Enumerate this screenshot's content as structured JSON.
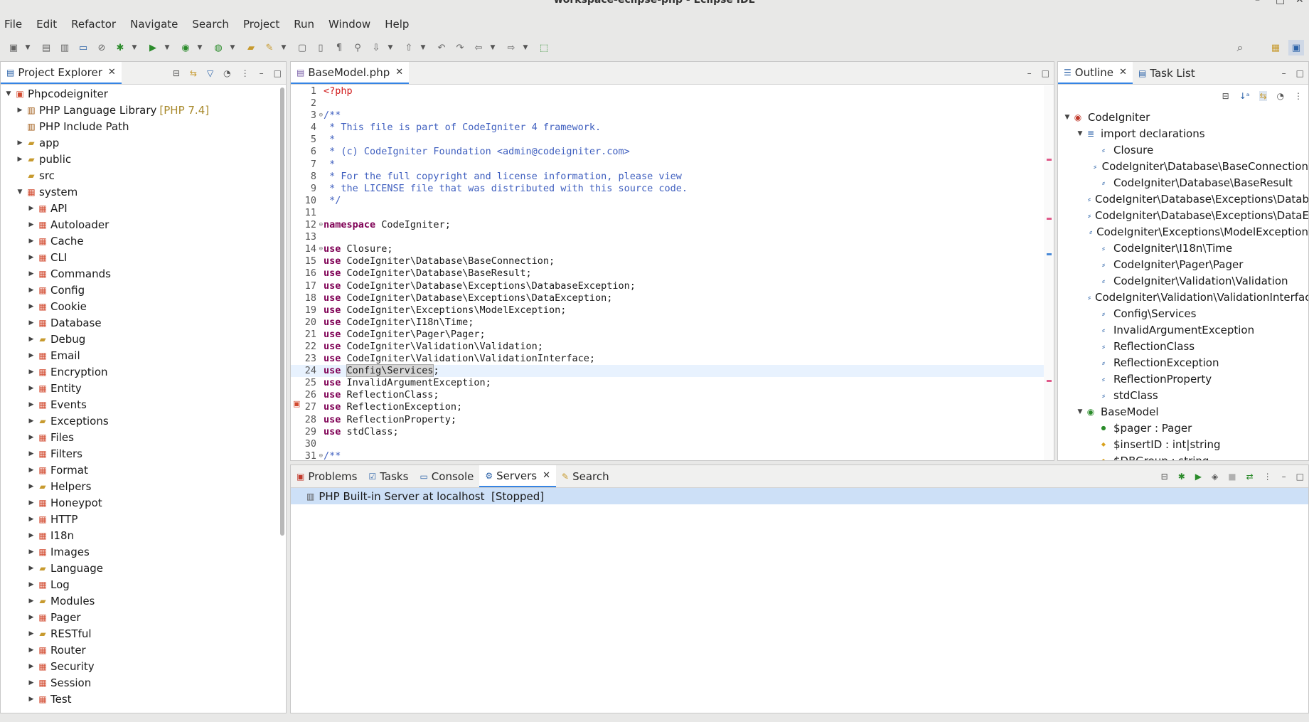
{
  "window": {
    "title": "workspace-eclipse-php - Eclipse IDE"
  },
  "menu": [
    "File",
    "Edit",
    "Refactor",
    "Navigate",
    "Search",
    "Project",
    "Run",
    "Window",
    "Help"
  ],
  "project_explorer": {
    "tab_label": "Project Explorer",
    "items": [
      {
        "label": "Phpcodeigniter",
        "level": 0,
        "expander": "open",
        "icon": "project-icon"
      },
      {
        "label": "PHP Language Library",
        "suffix": "[PHP 7.4]",
        "level": 1,
        "expander": "closed",
        "icon": "library-icon"
      },
      {
        "label": "PHP Include Path",
        "level": 1,
        "expander": "none",
        "icon": "library-icon"
      },
      {
        "label": "app",
        "level": 1,
        "expander": "closed",
        "icon": "folder-icon"
      },
      {
        "label": "public",
        "level": 1,
        "expander": "closed",
        "icon": "folder-icon"
      },
      {
        "label": "src",
        "level": 1,
        "expander": "none",
        "icon": "folder-icon"
      },
      {
        "label": "system",
        "level": 1,
        "expander": "open",
        "icon": "package-icon"
      },
      {
        "label": "API",
        "level": 2,
        "expander": "closed",
        "icon": "package-icon"
      },
      {
        "label": "Autoloader",
        "level": 2,
        "expander": "closed",
        "icon": "package-icon"
      },
      {
        "label": "Cache",
        "level": 2,
        "expander": "closed",
        "icon": "package-icon"
      },
      {
        "label": "CLI",
        "level": 2,
        "expander": "closed",
        "icon": "package-icon"
      },
      {
        "label": "Commands",
        "level": 2,
        "expander": "closed",
        "icon": "package-icon"
      },
      {
        "label": "Config",
        "level": 2,
        "expander": "closed",
        "icon": "package-icon"
      },
      {
        "label": "Cookie",
        "level": 2,
        "expander": "closed",
        "icon": "package-icon"
      },
      {
        "label": "Database",
        "level": 2,
        "expander": "closed",
        "icon": "package-icon"
      },
      {
        "label": "Debug",
        "level": 2,
        "expander": "closed",
        "icon": "folder-icon"
      },
      {
        "label": "Email",
        "level": 2,
        "expander": "closed",
        "icon": "package-icon"
      },
      {
        "label": "Encryption",
        "level": 2,
        "expander": "closed",
        "icon": "package-icon"
      },
      {
        "label": "Entity",
        "level": 2,
        "expander": "closed",
        "icon": "package-icon"
      },
      {
        "label": "Events",
        "level": 2,
        "expander": "closed",
        "icon": "package-icon"
      },
      {
        "label": "Exceptions",
        "level": 2,
        "expander": "closed",
        "icon": "folder-icon"
      },
      {
        "label": "Files",
        "level": 2,
        "expander": "closed",
        "icon": "package-icon"
      },
      {
        "label": "Filters",
        "level": 2,
        "expander": "closed",
        "icon": "package-icon"
      },
      {
        "label": "Format",
        "level": 2,
        "expander": "closed",
        "icon": "package-icon"
      },
      {
        "label": "Helpers",
        "level": 2,
        "expander": "closed",
        "icon": "folder-icon"
      },
      {
        "label": "Honeypot",
        "level": 2,
        "expander": "closed",
        "icon": "package-icon"
      },
      {
        "label": "HTTP",
        "level": 2,
        "expander": "closed",
        "icon": "package-icon"
      },
      {
        "label": "I18n",
        "level": 2,
        "expander": "closed",
        "icon": "package-icon"
      },
      {
        "label": "Images",
        "level": 2,
        "expander": "closed",
        "icon": "package-icon"
      },
      {
        "label": "Language",
        "level": 2,
        "expander": "closed",
        "icon": "folder-icon"
      },
      {
        "label": "Log",
        "level": 2,
        "expander": "closed",
        "icon": "package-icon"
      },
      {
        "label": "Modules",
        "level": 2,
        "expander": "closed",
        "icon": "folder-icon"
      },
      {
        "label": "Pager",
        "level": 2,
        "expander": "closed",
        "icon": "package-icon"
      },
      {
        "label": "RESTful",
        "level": 2,
        "expander": "closed",
        "icon": "folder-icon"
      },
      {
        "label": "Router",
        "level": 2,
        "expander": "closed",
        "icon": "package-icon"
      },
      {
        "label": "Security",
        "level": 2,
        "expander": "closed",
        "icon": "package-icon"
      },
      {
        "label": "Session",
        "level": 2,
        "expander": "closed",
        "icon": "package-icon"
      },
      {
        "label": "Test",
        "level": 2,
        "expander": "closed",
        "icon": "package-icon"
      }
    ]
  },
  "editor": {
    "tab_label": "BaseModel.php",
    "lines": [
      {
        "n": "1",
        "parts": [
          [
            "tag",
            "<?php"
          ]
        ]
      },
      {
        "n": "2",
        "parts": []
      },
      {
        "n": "3",
        "fold": true,
        "parts": [
          [
            "cm",
            "/**"
          ]
        ]
      },
      {
        "n": "4",
        "parts": [
          [
            "cm",
            " * This file is part of CodeIgniter 4 framework."
          ]
        ]
      },
      {
        "n": "5",
        "parts": [
          [
            "cm",
            " *"
          ]
        ]
      },
      {
        "n": "6",
        "parts": [
          [
            "cm",
            " * (c) CodeIgniter Foundation <admin@codeigniter.com>"
          ]
        ]
      },
      {
        "n": "7",
        "parts": [
          [
            "cm",
            " *"
          ]
        ]
      },
      {
        "n": "8",
        "parts": [
          [
            "cm",
            " * For the full copyright and license information, please view"
          ]
        ]
      },
      {
        "n": "9",
        "parts": [
          [
            "cm",
            " * the LICENSE file that was distributed with this source code."
          ]
        ]
      },
      {
        "n": "10",
        "parts": [
          [
            "cm",
            " */"
          ]
        ]
      },
      {
        "n": "11",
        "parts": []
      },
      {
        "n": "12",
        "fold": true,
        "parts": [
          [
            "kw",
            "namespace"
          ],
          [
            "",
            " CodeIgniter;"
          ]
        ]
      },
      {
        "n": "13",
        "parts": []
      },
      {
        "n": "14",
        "fold": true,
        "parts": [
          [
            "kw",
            "use"
          ],
          [
            "",
            " Closure;"
          ]
        ]
      },
      {
        "n": "15",
        "parts": [
          [
            "kw",
            "use"
          ],
          [
            "",
            " CodeIgniter\\Database\\BaseConnection;"
          ]
        ]
      },
      {
        "n": "16",
        "parts": [
          [
            "kw",
            "use"
          ],
          [
            "",
            " CodeIgniter\\Database\\BaseResult;"
          ]
        ]
      },
      {
        "n": "17",
        "parts": [
          [
            "kw",
            "use"
          ],
          [
            "",
            " CodeIgniter\\Database\\Exceptions\\DatabaseException;"
          ]
        ]
      },
      {
        "n": "18",
        "parts": [
          [
            "kw",
            "use"
          ],
          [
            "",
            " CodeIgniter\\Database\\Exceptions\\DataException;"
          ]
        ]
      },
      {
        "n": "19",
        "parts": [
          [
            "kw",
            "use"
          ],
          [
            "",
            " CodeIgniter\\Exceptions\\ModelException;"
          ]
        ]
      },
      {
        "n": "20",
        "parts": [
          [
            "kw",
            "use"
          ],
          [
            "",
            " CodeIgniter\\I18n\\Time;"
          ]
        ]
      },
      {
        "n": "21",
        "parts": [
          [
            "kw",
            "use"
          ],
          [
            "",
            " CodeIgniter\\Pager\\Pager;"
          ]
        ]
      },
      {
        "n": "22",
        "parts": [
          [
            "kw",
            "use"
          ],
          [
            "",
            " CodeIgniter\\Validation\\Validation;"
          ]
        ]
      },
      {
        "n": "23",
        "parts": [
          [
            "kw",
            "use"
          ],
          [
            "",
            " CodeIgniter\\Validation\\ValidationInterface;"
          ]
        ]
      },
      {
        "n": "24",
        "highlight": true,
        "parts": [
          [
            "kw",
            "use"
          ],
          [
            "",
            " "
          ],
          [
            "sel",
            "Config\\Services"
          ],
          [
            "",
            ";"
          ]
        ]
      },
      {
        "n": "25",
        "parts": [
          [
            "kw",
            "use"
          ],
          [
            "",
            " InvalidArgumentException;"
          ]
        ]
      },
      {
        "n": "26",
        "parts": [
          [
            "kw",
            "use"
          ],
          [
            "",
            " ReflectionClass;"
          ]
        ]
      },
      {
        "n": "27",
        "parts": [
          [
            "kw",
            "use"
          ],
          [
            "",
            " ReflectionException;"
          ]
        ]
      },
      {
        "n": "28",
        "parts": [
          [
            "kw",
            "use"
          ],
          [
            "",
            " ReflectionProperty;"
          ]
        ]
      },
      {
        "n": "29",
        "parts": [
          [
            "kw",
            "use"
          ],
          [
            "",
            " stdClass;"
          ]
        ]
      },
      {
        "n": "30",
        "parts": []
      },
      {
        "n": "31",
        "fold": true,
        "parts": [
          [
            "cm",
            "/**"
          ]
        ]
      }
    ]
  },
  "outline": {
    "tabs": [
      "Outline",
      "Task List"
    ],
    "items": [
      {
        "label": "CodeIgniter",
        "level": 0,
        "expander": "open",
        "icon": "namespace-icon"
      },
      {
        "label": "import declarations",
        "level": 1,
        "expander": "open",
        "icon": "imports-icon"
      },
      {
        "label": "Closure",
        "level": 2,
        "icon": "import-icon"
      },
      {
        "label": "CodeIgniter\\Database\\BaseConnection",
        "level": 2,
        "icon": "import-icon"
      },
      {
        "label": "CodeIgniter\\Database\\BaseResult",
        "level": 2,
        "icon": "import-icon"
      },
      {
        "label": "CodeIgniter\\Database\\Exceptions\\DatabaseException",
        "level": 2,
        "icon": "import-icon"
      },
      {
        "label": "CodeIgniter\\Database\\Exceptions\\DataException",
        "level": 2,
        "icon": "import-icon"
      },
      {
        "label": "CodeIgniter\\Exceptions\\ModelException",
        "level": 2,
        "icon": "import-icon"
      },
      {
        "label": "CodeIgniter\\I18n\\Time",
        "level": 2,
        "icon": "import-icon"
      },
      {
        "label": "CodeIgniter\\Pager\\Pager",
        "level": 2,
        "icon": "import-icon"
      },
      {
        "label": "CodeIgniter\\Validation\\Validation",
        "level": 2,
        "icon": "import-icon"
      },
      {
        "label": "CodeIgniter\\Validation\\ValidationInterface",
        "level": 2,
        "icon": "import-icon"
      },
      {
        "label": "Config\\Services",
        "level": 2,
        "icon": "import-icon"
      },
      {
        "label": "InvalidArgumentException",
        "level": 2,
        "icon": "import-icon"
      },
      {
        "label": "ReflectionClass",
        "level": 2,
        "icon": "import-icon"
      },
      {
        "label": "ReflectionException",
        "level": 2,
        "icon": "import-icon"
      },
      {
        "label": "ReflectionProperty",
        "level": 2,
        "icon": "import-icon"
      },
      {
        "label": "stdClass",
        "level": 2,
        "icon": "import-icon"
      },
      {
        "label": "BaseModel",
        "level": 1,
        "expander": "open",
        "icon": "class-icon"
      },
      {
        "label": "$pager : Pager",
        "level": 2,
        "icon": "public-field-icon"
      },
      {
        "label": "$insertID : int|string",
        "level": 2,
        "icon": "protected-field-icon"
      },
      {
        "label": "$DBGroup : string",
        "level": 2,
        "icon": "protected-field-icon"
      }
    ]
  },
  "bottom": {
    "tabs": [
      {
        "label": "Problems",
        "icon": "problems-icon"
      },
      {
        "label": "Tasks",
        "icon": "tasks-icon"
      },
      {
        "label": "Console",
        "icon": "console-icon"
      },
      {
        "label": "Servers",
        "icon": "servers-icon",
        "active": true
      },
      {
        "label": "Search",
        "icon": "search-icon"
      }
    ],
    "server_row": "PHP Built-in Server at localhost  [Stopped]"
  },
  "colors": {
    "accent": "#3584e4",
    "keyword": "#7f0055",
    "comment": "#3f5fbf",
    "php_tag": "#d11a1a",
    "selection_row": "#cde0f7"
  }
}
